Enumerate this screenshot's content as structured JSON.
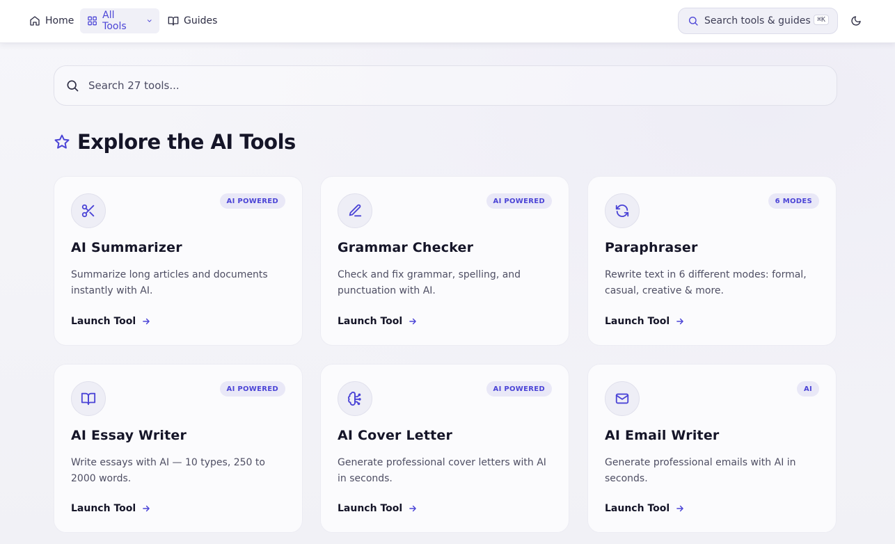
{
  "nav": {
    "home": "Home",
    "all_tools": "All Tools",
    "guides": "Guides",
    "search_placeholder": "Search tools & guides",
    "shortcut": "⌘K"
  },
  "main_search": {
    "placeholder": "Search 27 tools..."
  },
  "section": {
    "title": "Explore the AI Tools"
  },
  "accent_color": "#4b44d6",
  "cards": [
    {
      "icon": "scissors-icon",
      "badge": "AI POWERED",
      "title": "AI Summarizer",
      "description": "Summarize long articles and documents instantly with AI.",
      "cta": "Launch Tool"
    },
    {
      "icon": "pen-icon",
      "badge": "AI POWERED",
      "title": "Grammar Checker",
      "description": "Check and fix grammar, spelling, and punctuation with AI.",
      "cta": "Launch Tool"
    },
    {
      "icon": "refresh-icon",
      "badge": "6 MODES",
      "title": "Paraphraser",
      "description": "Rewrite text in 6 different modes: formal, casual, creative & more.",
      "cta": "Launch Tool"
    },
    {
      "icon": "book-open-icon",
      "badge": "AI POWERED",
      "title": "AI Essay Writer",
      "description": "Write essays with AI — 10 types, 250 to 2000 words.",
      "cta": "Launch Tool"
    },
    {
      "icon": "brain-circuit-icon",
      "badge": "AI POWERED",
      "title": "AI Cover Letter",
      "description": "Generate professional cover letters with AI in seconds.",
      "cta": "Launch Tool"
    },
    {
      "icon": "mail-icon",
      "badge": "AI",
      "title": "AI Email Writer",
      "description": "Generate professional emails with AI in seconds.",
      "cta": "Launch Tool"
    }
  ]
}
